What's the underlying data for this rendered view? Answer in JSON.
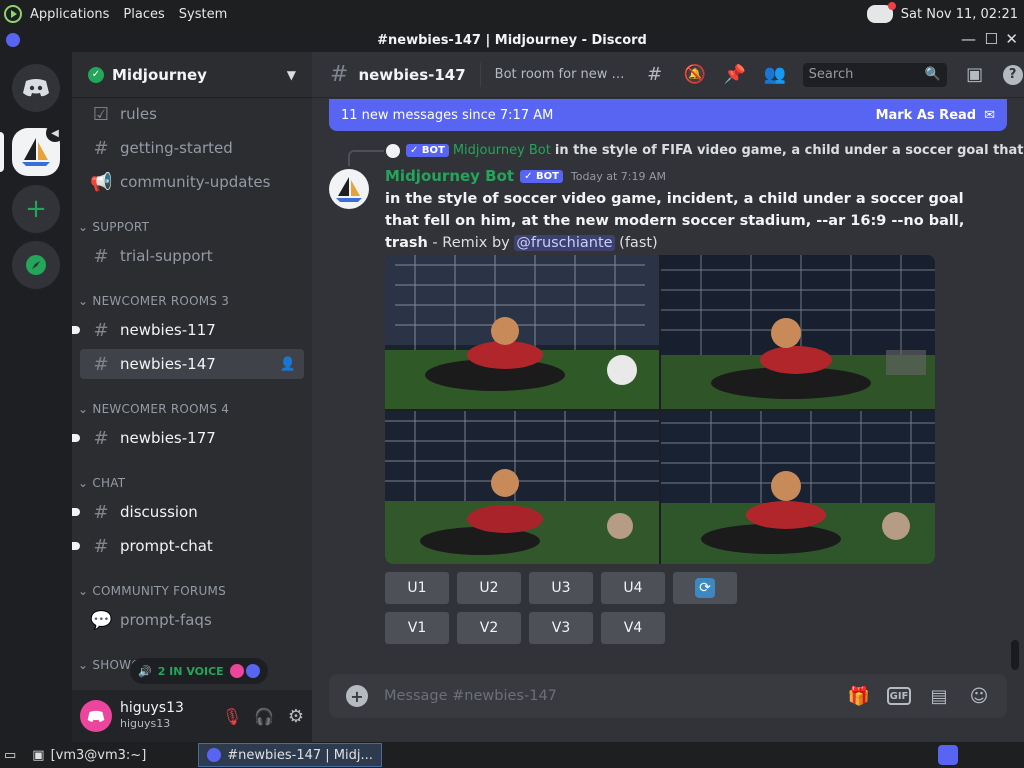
{
  "os": {
    "menus": [
      "Applications",
      "Places",
      "System"
    ],
    "clock": "Sat Nov 11, 02:21"
  },
  "window": {
    "title": "#newbies-147 | Midjourney - Discord",
    "controls": [
      "—",
      "☐",
      "✕"
    ]
  },
  "guild": {
    "name": "Midjourney"
  },
  "channels": {
    "rules": "rules",
    "getting_started": "getting-started",
    "community_updates": "community-updates",
    "cat_support": "SUPPORT",
    "trial_support": "trial-support",
    "cat_newcomer3": "NEWCOMER ROOMS 3",
    "newbies_117": "newbies-117",
    "newbies_147": "newbies-147",
    "cat_newcomer4": "NEWCOMER ROOMS 4",
    "newbies_177": "newbies-177",
    "cat_chat": "CHAT",
    "discussion": "discussion",
    "prompt_chat": "prompt-chat",
    "cat_forums": "COMMUNITY FORUMS",
    "prompt_faqs": "prompt-faqs",
    "cat_showcase": "SHOWC"
  },
  "voice_pill": "2 IN VOICE",
  "user": {
    "display_name": "higuys13",
    "username": "higuys13"
  },
  "header": {
    "channel": "newbies-147",
    "topic": "Bot room for new users...",
    "search_placeholder": "Search"
  },
  "new_messages": {
    "text": "11 new messages since 7:17 AM",
    "action": "Mark As Read"
  },
  "reply": {
    "bot_tag": "BOT",
    "author": "Midjourney Bot",
    "snippet": "in the style of FIFA video game, a child under a soccer goal that"
  },
  "message": {
    "author": "Midjourney Bot",
    "bot_tag": "BOT",
    "time": "Today at 7:19 AM",
    "prompt": "in the style of soccer video game, incident, a child under a soccer goal that fell on him, at the new modern soccer stadium, --ar 16:9 --no ball, trash",
    "suffix": " - Remix by ",
    "mention": "@fruschiante",
    "speed": " (fast)"
  },
  "buttons": {
    "u": [
      "U1",
      "U2",
      "U3",
      "U4"
    ],
    "v": [
      "V1",
      "V2",
      "V3",
      "V4"
    ]
  },
  "composer": {
    "placeholder": "Message #newbies-147"
  },
  "taskbar": {
    "terminal": "[vm3@vm3:~]",
    "discord": "#newbies-147 | Midj..."
  },
  "colors": {
    "blurple": "#5865f2",
    "green": "#23a55a",
    "bg": "#313338",
    "sidebar": "#2b2d31"
  }
}
